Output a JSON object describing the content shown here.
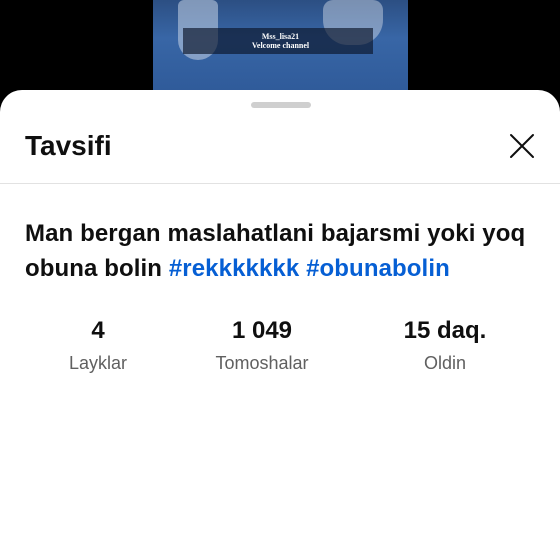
{
  "video": {
    "watermark_line1": "Mss_lisa21",
    "watermark_line2": "Velcome channel"
  },
  "sheet": {
    "title": "Tavsifi",
    "close_icon": "close-icon",
    "description": {
      "text": "Man bergan maslahatlani bajarsmi yoki yoq obuna bolin ",
      "hashtags": [
        "#rekkkkkkk",
        "#obunabolin"
      ]
    },
    "stats": [
      {
        "value": "4",
        "label": "Layklar"
      },
      {
        "value": "1 049",
        "label": "Tomoshalar"
      },
      {
        "value": "15 daq.",
        "label": "Oldin"
      }
    ]
  },
  "colors": {
    "hashtag": "#065fd4",
    "text": "#0f0f0f",
    "secondary_text": "#606060",
    "background": "#ffffff"
  }
}
